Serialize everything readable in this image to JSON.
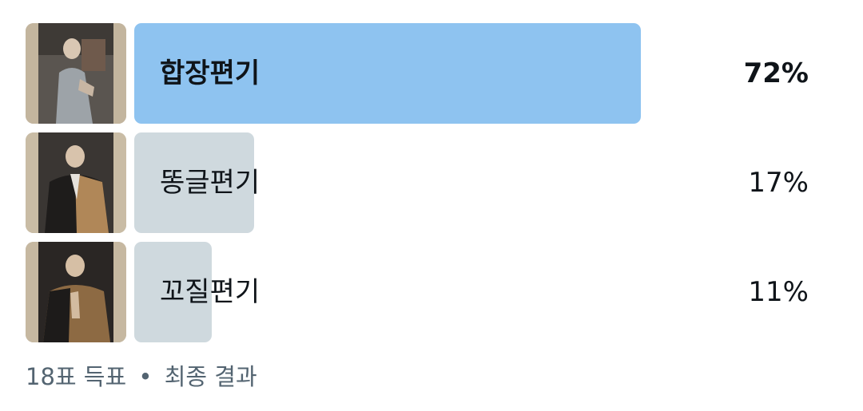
{
  "poll": {
    "options": [
      {
        "label": "합장편기",
        "percent_text": "72%",
        "percent": 72,
        "winner": true
      },
      {
        "label": "똥글편기",
        "percent_text": "17%",
        "percent": 17,
        "winner": false
      },
      {
        "label": "꼬질편기",
        "percent_text": "11%",
        "percent": 11,
        "winner": false
      }
    ],
    "footer": {
      "votes": "18표 득표",
      "separator": "•",
      "status": "최종 결과"
    }
  },
  "colors": {
    "winner_bar": "#8ec3f0",
    "other_bar": "#cfd9de",
    "text": "#0f1419",
    "muted_text": "#536471"
  },
  "icons": {
    "thumbnails": [
      "photo-thumbnail-monk-gray-robe",
      "photo-thumbnail-monk-tan-robe",
      "photo-thumbnail-monk-praying"
    ]
  }
}
